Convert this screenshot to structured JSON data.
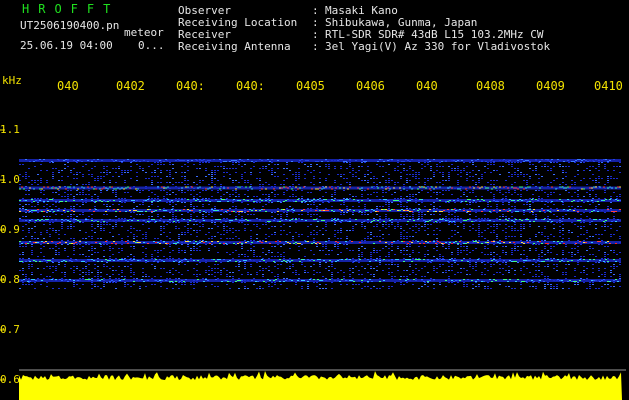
{
  "app": {
    "title": "HROFFT"
  },
  "file": {
    "name": "UT2506190400.pn",
    "tag": "meteor",
    "datetime": "25.06.19 04:00",
    "count": "0..."
  },
  "header": [
    {
      "label": "Observer",
      "value": "Masaki Kano"
    },
    {
      "label": "Receiving Location",
      "value": "Shibukawa, Gunma, Japan"
    },
    {
      "label": "Receiver",
      "value": "RTL-SDR SDR# 43dB L15 103.2MHz CW"
    },
    {
      "label": "Receiving Antenna",
      "value": "3el Yagi(V) Az 330 for Vladivostok"
    }
  ],
  "colon": ":",
  "plot": {
    "unit": "kHz",
    "y_ticks": [
      "1.1",
      "1.0",
      "0.9",
      "0.8",
      "0.7",
      "0.6"
    ],
    "x_ticks": [
      "040",
      "0402",
      "040:",
      "040:",
      "0405",
      "0406",
      "040",
      "0408",
      "0409",
      "0410"
    ],
    "colors": {
      "background": "#000000",
      "axis_text": "#f2e200",
      "amplitude": "#ffff00",
      "grid": "#9a9a9a",
      "noise": "#1a2bd0"
    }
  },
  "chart_data": {
    "type": "heatmap",
    "unit": "kHz",
    "y_ticks": [
      1.1,
      1.0,
      0.9,
      0.8,
      0.7,
      0.6
    ],
    "signal_bands_khz": [
      {
        "freq": 1.04,
        "strength": "weak"
      },
      {
        "freq": 0.985,
        "strength": "strong"
      },
      {
        "freq": 0.96,
        "strength": "medium"
      },
      {
        "freq": 0.94,
        "strength": "strong"
      },
      {
        "freq": 0.92,
        "strength": "medium"
      },
      {
        "freq": 0.876,
        "strength": "very strong"
      },
      {
        "freq": 0.84,
        "strength": "medium"
      },
      {
        "freq": 0.8,
        "strength": "medium"
      }
    ],
    "spectrum_range_khz": [
      0.78,
      1.04
    ]
  }
}
